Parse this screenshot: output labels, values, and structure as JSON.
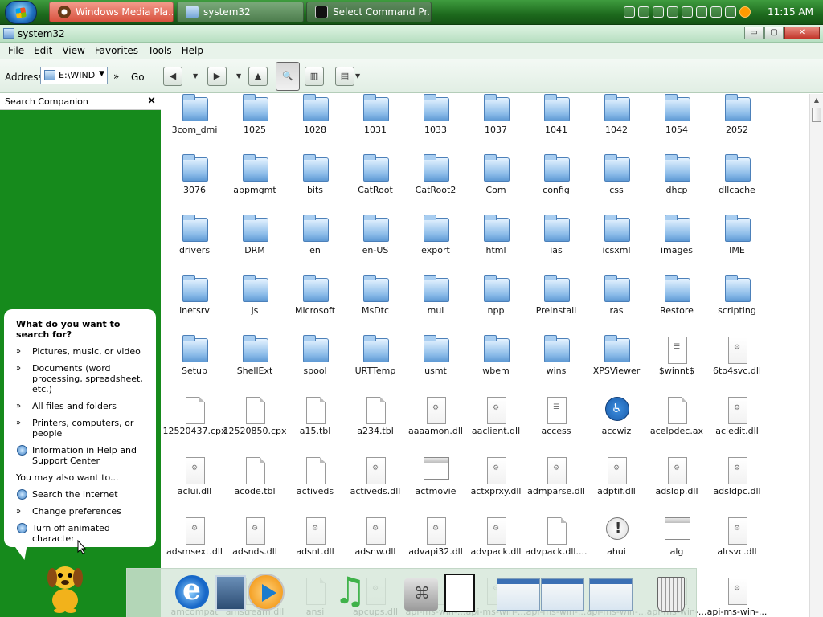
{
  "taskbar": {
    "tasks": [
      {
        "label": "Windows Media Pla..."
      },
      {
        "label": "system32"
      },
      {
        "label": "Select Command Pr..."
      }
    ],
    "clock": "11:15 AM"
  },
  "window": {
    "title": "system32",
    "buttons": {
      "minimize": "▭",
      "maximize": "▢",
      "close": "✕"
    }
  },
  "menu": [
    "File",
    "Edit",
    "View",
    "Favorites",
    "Tools",
    "Help"
  ],
  "toolbar": {
    "address_label": "Address",
    "address_value": "E:\\WIND",
    "go_label": "Go",
    "go_arrow": "»"
  },
  "pane": {
    "title": "Search Companion",
    "close": "×",
    "question": "What do you want to search for?",
    "options": [
      "Pictures, music, or video",
      "Documents (word processing, spreadsheet, etc.)",
      "All files and folders",
      "Printers, computers, or people",
      "Information in Help and Support Center"
    ],
    "also_label": "You may also want to...",
    "also_options": [
      "Search the Internet",
      "Change preferences",
      "Turn off animated character"
    ]
  },
  "files": [
    {
      "name": "3com_dmi",
      "type": "folder"
    },
    {
      "name": "1025",
      "type": "folder"
    },
    {
      "name": "1028",
      "type": "folder"
    },
    {
      "name": "1031",
      "type": "folder"
    },
    {
      "name": "1033",
      "type": "folder"
    },
    {
      "name": "1037",
      "type": "folder"
    },
    {
      "name": "1041",
      "type": "folder"
    },
    {
      "name": "1042",
      "type": "folder"
    },
    {
      "name": "1054",
      "type": "folder"
    },
    {
      "name": "2052",
      "type": "folder"
    },
    {
      "name": "3076",
      "type": "folder"
    },
    {
      "name": "appmgmt",
      "type": "folder"
    },
    {
      "name": "bits",
      "type": "folder"
    },
    {
      "name": "CatRoot",
      "type": "folder"
    },
    {
      "name": "CatRoot2",
      "type": "folder"
    },
    {
      "name": "Com",
      "type": "folder"
    },
    {
      "name": "config",
      "type": "folder"
    },
    {
      "name": "css",
      "type": "folder"
    },
    {
      "name": "dhcp",
      "type": "folder"
    },
    {
      "name": "dllcache",
      "type": "folder"
    },
    {
      "name": "drivers",
      "type": "folder"
    },
    {
      "name": "DRM",
      "type": "folder"
    },
    {
      "name": "en",
      "type": "folder"
    },
    {
      "name": "en-US",
      "type": "folder"
    },
    {
      "name": "export",
      "type": "folder"
    },
    {
      "name": "html",
      "type": "folder"
    },
    {
      "name": "ias",
      "type": "folder"
    },
    {
      "name": "icsxml",
      "type": "folder"
    },
    {
      "name": "images",
      "type": "folder"
    },
    {
      "name": "IME",
      "type": "folder"
    },
    {
      "name": "inetsrv",
      "type": "folder"
    },
    {
      "name": "js",
      "type": "folder"
    },
    {
      "name": "Microsoft",
      "type": "folder"
    },
    {
      "name": "MsDtc",
      "type": "folder"
    },
    {
      "name": "mui",
      "type": "folder"
    },
    {
      "name": "npp",
      "type": "folder"
    },
    {
      "name": "PreInstall",
      "type": "folder"
    },
    {
      "name": "ras",
      "type": "folder"
    },
    {
      "name": "Restore",
      "type": "folder"
    },
    {
      "name": "scripting",
      "type": "folder"
    },
    {
      "name": "Setup",
      "type": "folder"
    },
    {
      "name": "ShellExt",
      "type": "folder"
    },
    {
      "name": "spool",
      "type": "folder"
    },
    {
      "name": "URTTemp",
      "type": "folder"
    },
    {
      "name": "usmt",
      "type": "folder"
    },
    {
      "name": "wbem",
      "type": "folder"
    },
    {
      "name": "wins",
      "type": "folder"
    },
    {
      "name": "XPSViewer",
      "type": "folder"
    },
    {
      "name": "$winnt$",
      "type": "shortcut"
    },
    {
      "name": "6to4svc.dll",
      "type": "dll"
    },
    {
      "name": "12520437.cpx",
      "type": "file"
    },
    {
      "name": "12520850.cpx",
      "type": "file"
    },
    {
      "name": "a15.tbl",
      "type": "file"
    },
    {
      "name": "a234.tbl",
      "type": "file"
    },
    {
      "name": "aaaamon.dll",
      "type": "dll"
    },
    {
      "name": "aaclient.dll",
      "type": "dll"
    },
    {
      "name": "access",
      "type": "shortcut"
    },
    {
      "name": "accwiz",
      "type": "access"
    },
    {
      "name": "acelpdec.ax",
      "type": "file"
    },
    {
      "name": "acledit.dll",
      "type": "dll"
    },
    {
      "name": "aclui.dll",
      "type": "dll"
    },
    {
      "name": "acode.tbl",
      "type": "file"
    },
    {
      "name": "activeds",
      "type": "file"
    },
    {
      "name": "activeds.dll",
      "type": "dll"
    },
    {
      "name": "actmovie",
      "type": "app"
    },
    {
      "name": "actxprxy.dll",
      "type": "dll"
    },
    {
      "name": "admparse.dll",
      "type": "dll"
    },
    {
      "name": "adptif.dll",
      "type": "dll"
    },
    {
      "name": "adsldp.dll",
      "type": "dll"
    },
    {
      "name": "adsldpc.dll",
      "type": "dll"
    },
    {
      "name": "adsmsext.dll",
      "type": "dll"
    },
    {
      "name": "adsnds.dll",
      "type": "dll"
    },
    {
      "name": "adsnt.dll",
      "type": "dll"
    },
    {
      "name": "adsnw.dll",
      "type": "dll"
    },
    {
      "name": "advapi32.dll",
      "type": "dll"
    },
    {
      "name": "advpack.dll",
      "type": "dll"
    },
    {
      "name": "advpack.dll....",
      "type": "file"
    },
    {
      "name": "ahui",
      "type": "help"
    },
    {
      "name": "alg",
      "type": "app"
    },
    {
      "name": "alrsvc.dll",
      "type": "dll"
    },
    {
      "name": "amcompat",
      "type": "file"
    },
    {
      "name": "amstream.dll",
      "type": "dll"
    },
    {
      "name": "ansi",
      "type": "file"
    },
    {
      "name": "apcups.dll",
      "type": "dll"
    },
    {
      "name": "api-ms-win-...",
      "type": "dll"
    },
    {
      "name": "api-ms-win-...",
      "type": "dll"
    },
    {
      "name": "api-ms-win-...",
      "type": "dll"
    },
    {
      "name": "api-ms-win-...",
      "type": "dll"
    },
    {
      "name": "api-ms-win-...",
      "type": "dll"
    },
    {
      "name": "api-ms-win-...",
      "type": "dll"
    }
  ],
  "dock": [
    "internet-explorer",
    "bird-photo",
    "media-player",
    "music-player",
    "mac-finder",
    "document",
    "window",
    "window",
    "window",
    "trash"
  ]
}
